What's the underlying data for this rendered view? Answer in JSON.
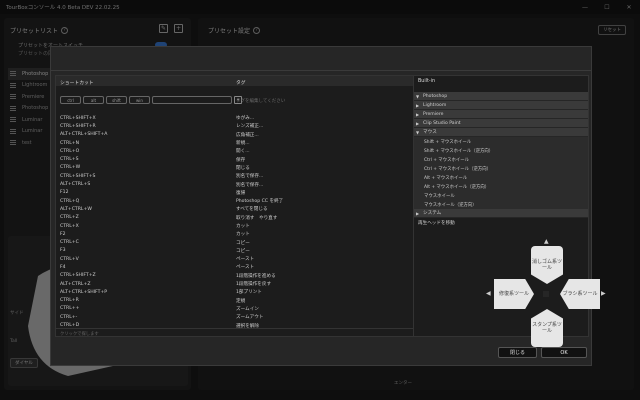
{
  "app": {
    "title": "TourBoxコンソール 4.0 Beta DEV 22.02.25",
    "window_controls": [
      "—",
      "☐",
      "✕"
    ]
  },
  "left_panel": {
    "heading": "プリセットリスト",
    "auto_switch_label": "プリセットをオートスイッチ",
    "auto_switch_sub": "プリセットの同期",
    "presets": [
      "Photoshop",
      "Lightroom",
      "Premiere",
      "Photoshop",
      "Luminar",
      "Luminar",
      "test"
    ],
    "device_labels": {
      "side": "サイド",
      "tall": "Tall"
    },
    "device_tag": "ダイヤル"
  },
  "right_panel": {
    "heading": "プリセット設定",
    "reset_label": "リセット",
    "enter_label": "エンター"
  },
  "modal": {
    "list": {
      "col_shortcut": "ショートカット",
      "col_tag": "タグ",
      "modifier_keys": [
        "ctrl",
        "alt",
        "shift",
        "win"
      ],
      "key_placeholder": "",
      "tag_placeholder": "タグを編集してください",
      "search_placeholder": "クリックで探します",
      "rows": [
        {
          "shortcut": "CTRL+SHIFT+X",
          "tag": "ゆがみ..."
        },
        {
          "shortcut": "CTRL+SHIFT+R",
          "tag": "レンズ補正..."
        },
        {
          "shortcut": "ALT+CTRL+SHIFT+A",
          "tag": "広角補正..."
        },
        {
          "shortcut": "CTRL+N",
          "tag": "新規..."
        },
        {
          "shortcut": "CTRL+O",
          "tag": "開く..."
        },
        {
          "shortcut": "CTRL+S",
          "tag": "保存"
        },
        {
          "shortcut": "CTRL+W",
          "tag": "閉じる"
        },
        {
          "shortcut": "CTRL+SHIFT+S",
          "tag": "別名で保存..."
        },
        {
          "shortcut": "ALT+CTRL+S",
          "tag": "別名で保存..."
        },
        {
          "shortcut": "F12",
          "tag": "復帰"
        },
        {
          "shortcut": "CTRL+Q",
          "tag": "Photoshop CC を終了"
        },
        {
          "shortcut": "ALT+CTRL+W",
          "tag": "すべてを閉じる"
        },
        {
          "shortcut": "CTRL+Z",
          "tag": "取り消す　やり直す"
        },
        {
          "shortcut": "CTRL+X",
          "tag": "カット"
        },
        {
          "shortcut": "F2",
          "tag": "カット"
        },
        {
          "shortcut": "CTRL+C",
          "tag": "コピー"
        },
        {
          "shortcut": "F3",
          "tag": "コピー"
        },
        {
          "shortcut": "CTRL+V",
          "tag": "ペースト"
        },
        {
          "shortcut": "F4",
          "tag": "ペースト"
        },
        {
          "shortcut": "CTRL+SHIFT+Z",
          "tag": "1段階操作を進める"
        },
        {
          "shortcut": "ALT+CTRL+Z",
          "tag": "1段階操作を戻す"
        },
        {
          "shortcut": "ALT+CTRL+SHIFT+P",
          "tag": "1部プリント"
        },
        {
          "shortcut": "CTRL+R",
          "tag": "定規"
        },
        {
          "shortcut": "CTRL++",
          "tag": "ズームイン"
        },
        {
          "shortcut": "CTRL+-",
          "tag": "ズームアウト"
        },
        {
          "shortcut": "CTRL+D",
          "tag": "選択を解除"
        }
      ]
    },
    "tree": {
      "header": "Built-in",
      "apps": [
        {
          "name": "Photoshop",
          "open": true
        },
        {
          "name": "Lightroom",
          "open": false
        },
        {
          "name": "Premiere",
          "open": false
        },
        {
          "name": "Clip Studio Paint",
          "open": false
        },
        {
          "name": "マウス",
          "open": true
        }
      ],
      "mouse_items": [
        "Shift + マウスホイール",
        "Shift + マウスホイール（逆方向）",
        "Ctrl + マウスホイール",
        "Ctrl + マウスホイール（逆方向）",
        "Alt + マウスホイール",
        "Alt + マウスホイール（逆方向）",
        "マウスホイール",
        "マウスホイール（逆方向）"
      ],
      "system": "システム",
      "leaf": "再生ヘッドを移動"
    },
    "dial": {
      "up": "消しゴム系ツール",
      "left": "修復系ツール",
      "right": "ブラシ系ツール",
      "down": "スタンプ系ツール"
    },
    "buttons": {
      "close": "閉じる",
      "ok": "OK"
    }
  }
}
